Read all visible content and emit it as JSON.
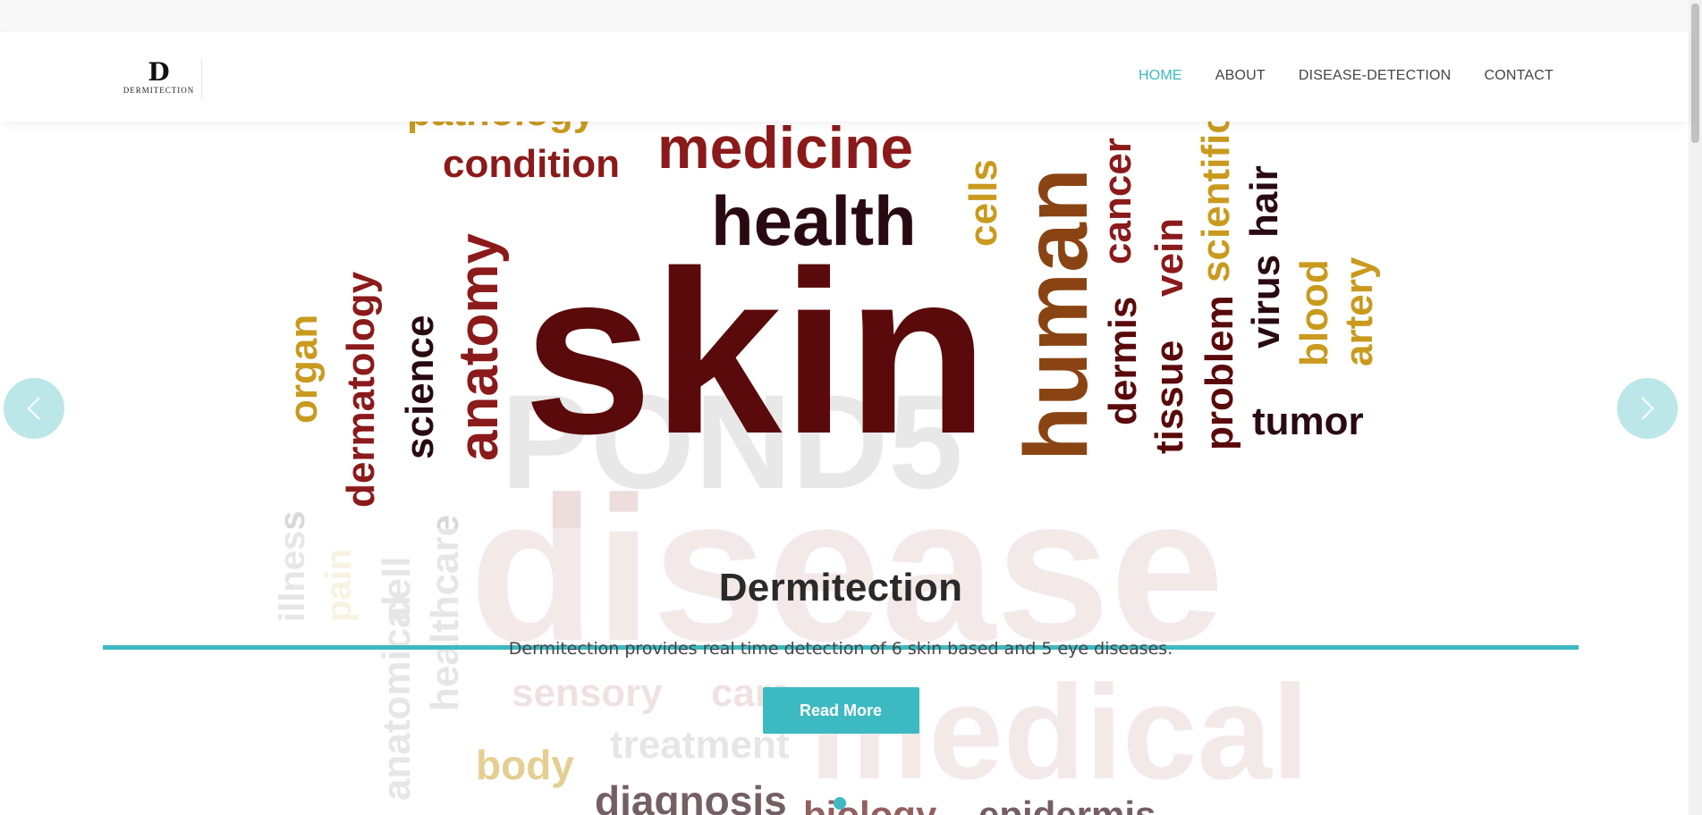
{
  "brand": {
    "logo_mark": "D",
    "logo_text": "DERMITECTION"
  },
  "nav": [
    {
      "label": "HOME",
      "active": true
    },
    {
      "label": "ABOUT",
      "active": false
    },
    {
      "label": "DISEASE-DETECTION",
      "active": false
    },
    {
      "label": "CONTACT",
      "active": false
    }
  ],
  "hero": {
    "title": "Dermitection",
    "description": "Dermitection provides real time detection of 6 skin based and 5 eye diseases.",
    "button_label": "Read More",
    "watermark": "POND5",
    "words": {
      "skin": "skin",
      "health": "health",
      "medicine": "medicine",
      "condition": "condition",
      "pathology": "pathology",
      "cells": "cells",
      "human": "human",
      "cancer": "cancer",
      "scientific": "scientific",
      "hair": "hair",
      "virus": "virus",
      "blood": "blood",
      "artery": "artery",
      "vein": "vein",
      "tissue": "tissue",
      "dermis": "dermis",
      "problem": "problem",
      "tumor": "tumor",
      "organ": "organ",
      "dermatology": "dermatology",
      "science": "science",
      "anatomy": "anatomy",
      "illness": "illness",
      "pain": "pain",
      "healthcare": "healthcare",
      "cell": "cell",
      "anatomical": "anatomical",
      "disease": "disease",
      "sensory": "sensory",
      "care": "care",
      "medical": "medical",
      "treatment": "treatment",
      "body": "body",
      "diagnosis": "diagnosis",
      "biology": "biology",
      "epidermis": "epidermis"
    }
  },
  "icons": {
    "prev": "chevron-left-icon",
    "next": "chevron-right-icon"
  },
  "colors": {
    "accent": "#3db9c1",
    "dark_red": "#5a0a0a",
    "red": "#8b1a1a",
    "gold": "#c99a1e",
    "brown": "#8a4413"
  }
}
